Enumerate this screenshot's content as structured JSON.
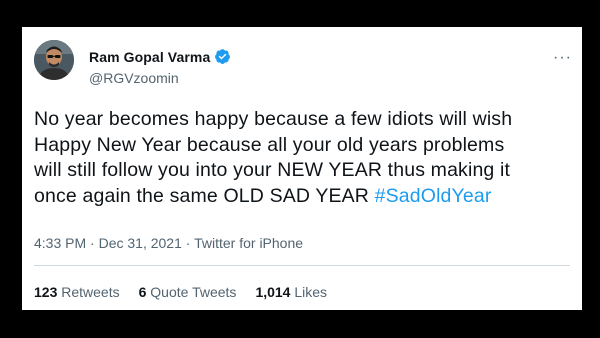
{
  "tweet": {
    "author": {
      "display_name": "Ram Gopal Varma",
      "handle": "@RGVzoomin",
      "verified": true,
      "avatar_icon": "profile-photo"
    },
    "more_icon": "ellipsis-icon",
    "text_lines": [
      "No year becomes happy because a few idiots will wish",
      "Happy New Year because all your old years problems",
      "will still follow you into your NEW YEAR thus making it",
      "once again the same OLD SAD YEAR "
    ],
    "hashtag": "#SadOldYear",
    "time": "4:33 PM",
    "separator": "·",
    "date": "Dec 31, 2021",
    "source": "Twitter for iPhone",
    "stats": {
      "retweets_count": "123",
      "retweets_label": "Retweets",
      "quote_tweets_count": "6",
      "quote_tweets_label": "Quote Tweets",
      "likes_count": "1,014",
      "likes_label": "Likes"
    }
  },
  "colors": {
    "background": "#000000",
    "card": "#ffffff",
    "text_primary": "#0f1419",
    "text_secondary": "#536471",
    "link": "#1d9bf0",
    "verified": "#1d9bf0"
  }
}
